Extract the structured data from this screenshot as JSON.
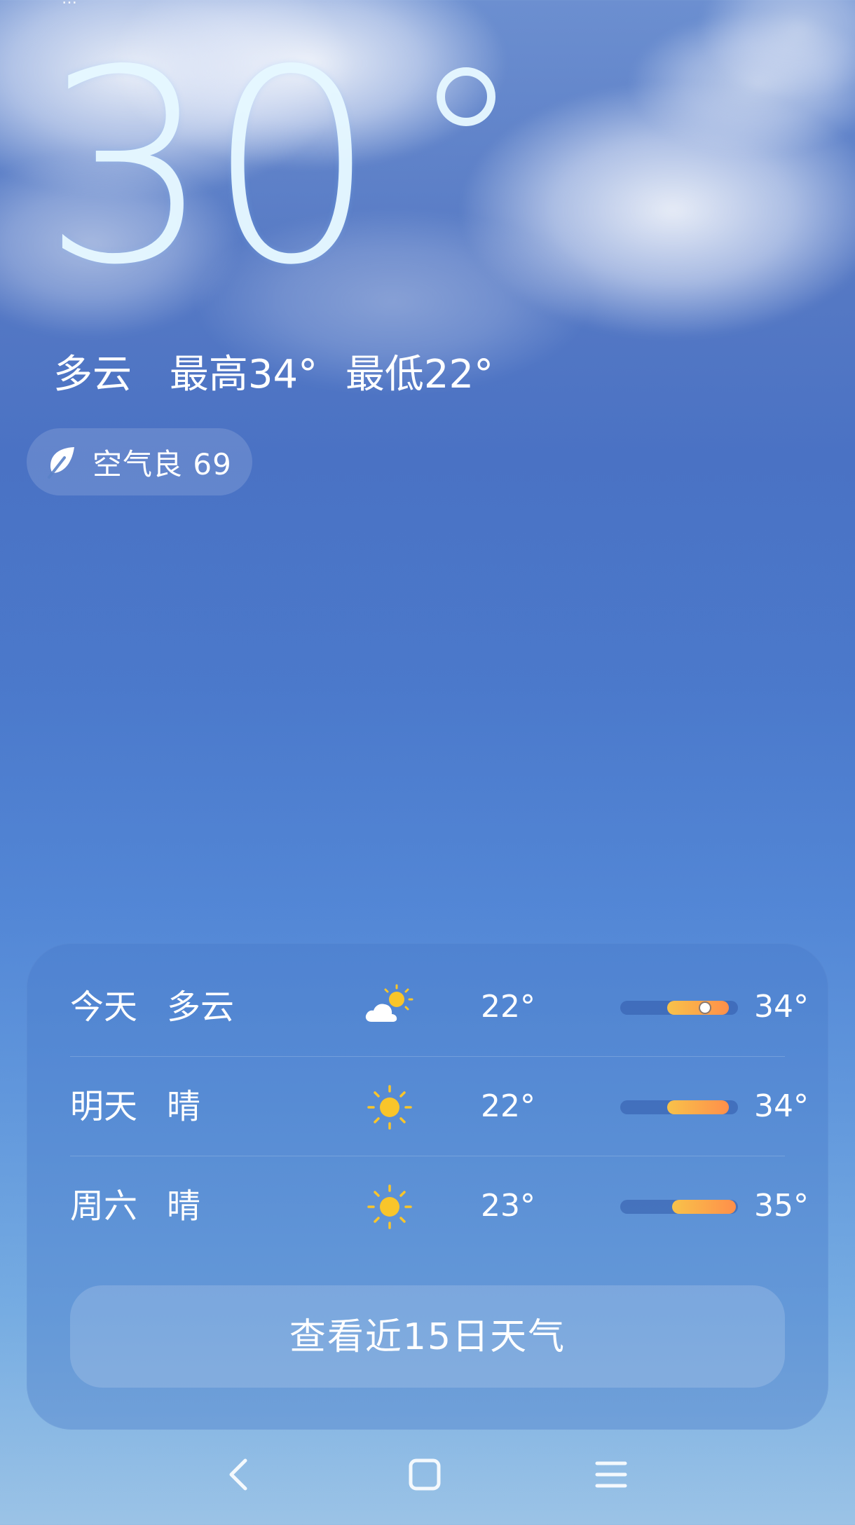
{
  "status_fragment": "…",
  "current": {
    "temperature": "30",
    "condition": "多云",
    "high_text": "最高34°",
    "low_text": "最低22°"
  },
  "air_quality": {
    "label": "空气良 69",
    "icon": "leaf-icon"
  },
  "forecast": {
    "rows": [
      {
        "day": "今天",
        "condition": "多云",
        "icon": "partly-cloudy-icon",
        "low": "22°",
        "high": "34°",
        "bar_start": 0.4,
        "bar_end": 0.92,
        "current_marker": 0.72
      },
      {
        "day": "明天",
        "condition": "晴",
        "icon": "sun-icon",
        "low": "22°",
        "high": "34°",
        "bar_start": 0.4,
        "bar_end": 0.92
      },
      {
        "day": "周六",
        "condition": "晴",
        "icon": "sun-icon",
        "low": "23°",
        "high": "35°",
        "bar_start": 0.44,
        "bar_end": 0.98
      }
    ],
    "view_more_label": "查看近15日天气"
  },
  "nav": {
    "back_icon": "back-chevron-icon",
    "home_icon": "home-square-icon",
    "menu_icon": "menu-lines-icon"
  },
  "colors": {
    "bar_warm_start": "#f8c24a",
    "bar_warm_end": "#ff8f4a",
    "sun": "#f9c52a"
  }
}
